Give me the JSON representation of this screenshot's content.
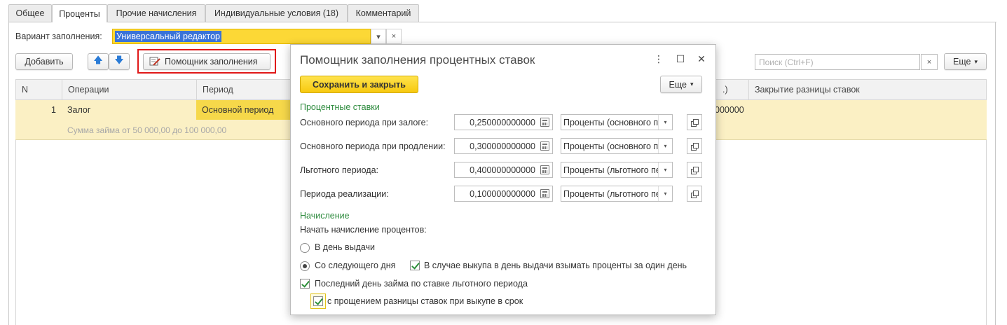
{
  "tabs": [
    {
      "label": "Общее",
      "active": false
    },
    {
      "label": "Проценты",
      "active": true
    },
    {
      "label": "Прочие начисления",
      "active": false
    },
    {
      "label": "Индивидуальные условия (18)",
      "active": false
    },
    {
      "label": "Комментарий",
      "active": false
    }
  ],
  "variant": {
    "label": "Вариант заполнения:",
    "value": "Универсальный редактор",
    "dropdown_glyph": "▾",
    "clear_glyph": "×"
  },
  "toolbar": {
    "add_label": "Добавить",
    "up_glyph": "🡅",
    "down_glyph": "🡇",
    "helper_label": "Помощник заполнения",
    "search_placeholder": "Поиск (Ctrl+F)",
    "search_clear": "×",
    "more_label": "Еще",
    "more_glyph": "▾"
  },
  "table": {
    "columns": [
      "N",
      "Операции",
      "Период",
      "",
      ".)",
      "Закрытие разницы ставок"
    ],
    "rows": [
      {
        "n": "1",
        "operation": "Залог",
        "period": "Основной период",
        "value_tail": "000000",
        "note": "Сумма займа от 50 000,00 до 100 000,00"
      }
    ]
  },
  "modal": {
    "title": "Помощник заполнения процентных ставок",
    "menu_glyph": "⋮",
    "maximize_glyph": "☐",
    "close_glyph": "✕",
    "save_label": "Сохранить и закрыть",
    "more_label": "Еще",
    "more_glyph": "▾",
    "rates_section": "Процентные ставки",
    "rates": [
      {
        "label": "Основного периода при залоге:",
        "value": "0,250000000000",
        "account": "Проценты (основного пер"
      },
      {
        "label": "Основного периода при продлении:",
        "value": "0,300000000000",
        "account": "Проценты (основного пер"
      },
      {
        "label": "Льготного периода:",
        "value": "0,400000000000",
        "account": "Проценты (льготного пери"
      },
      {
        "label": "Периода реализации:",
        "value": "0,100000000000",
        "account": "Проценты (льготного пери"
      }
    ],
    "select_glyph": "▾",
    "accrual_section": "Начисление",
    "accrual_start_label": "Начать начисление процентов:",
    "radio_issue_day": "В день выдачи",
    "radio_next_day": "Со следующего дня",
    "chk_buyout_same_day": "В случае выкупа в день выдачи взымать проценты за один день",
    "chk_last_day_grace": "Последний день займа по ставке льготного периода",
    "chk_forgive_diff": "с прощением разницы ставок при выкупе в срок"
  },
  "colors": {
    "accent_yellow": "#fcd836",
    "selection_blue": "#3a73d8",
    "section_green": "#2e8b3e",
    "highlight_red": "#e01818",
    "row_highlight": "#fbf0c4"
  }
}
